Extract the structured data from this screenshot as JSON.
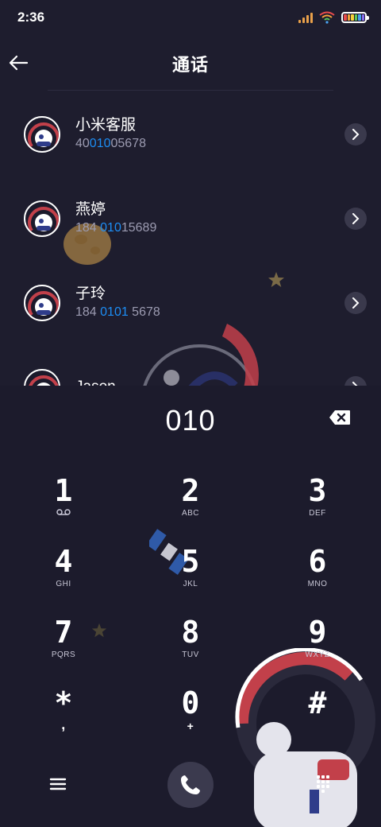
{
  "status": {
    "time": "2:36",
    "signal_icon": "signal-icon",
    "wifi_icon": "wifi-icon",
    "battery_icon": "battery-icon",
    "battery_colors": [
      "#e84c4c",
      "#f3a23a",
      "#f5d23c",
      "#5bc95a",
      "#4aa3f0",
      "#8a6ef0"
    ]
  },
  "header": {
    "title": "通话",
    "back_icon": "arrow-left-icon"
  },
  "contacts": [
    {
      "name": "小米客服",
      "number_pre": "40",
      "number_hl": "010",
      "number_post": "05678"
    },
    {
      "name": "燕婷",
      "number_pre": "184 ",
      "number_hl": "010",
      "number_post": "15689"
    },
    {
      "name": "子玲",
      "number_pre": "184 ",
      "number_hl": "0101",
      "number_post": " 5678"
    },
    {
      "name": "Jason",
      "number_pre": "",
      "number_hl": "",
      "number_post": ""
    }
  ],
  "dialer": {
    "display": "010",
    "backspace_icon": "backspace-icon",
    "keys": [
      {
        "digit": "1",
        "letters": ""
      },
      {
        "digit": "2",
        "letters": "ABC"
      },
      {
        "digit": "3",
        "letters": "DEF"
      },
      {
        "digit": "4",
        "letters": "GHI"
      },
      {
        "digit": "5",
        "letters": "JKL"
      },
      {
        "digit": "6",
        "letters": "MNO"
      },
      {
        "digit": "7",
        "letters": "PQRS"
      },
      {
        "digit": "8",
        "letters": "TUV"
      },
      {
        "digit": "9",
        "letters": "WXYZ"
      },
      {
        "digit": "*",
        "letters": ","
      },
      {
        "digit": "0",
        "letters": "+"
      },
      {
        "digit": "#",
        "letters": ""
      }
    ],
    "voicemail_icon": "voicemail-icon"
  },
  "bottom_bar": {
    "menu_icon": "menu-icon",
    "call_icon": "phone-icon",
    "keypad_icon": "keypad-icon"
  },
  "colors": {
    "background": "#1e1d2e",
    "highlight": "#1d8ef5",
    "secondary_text": "#9c9bb1"
  }
}
